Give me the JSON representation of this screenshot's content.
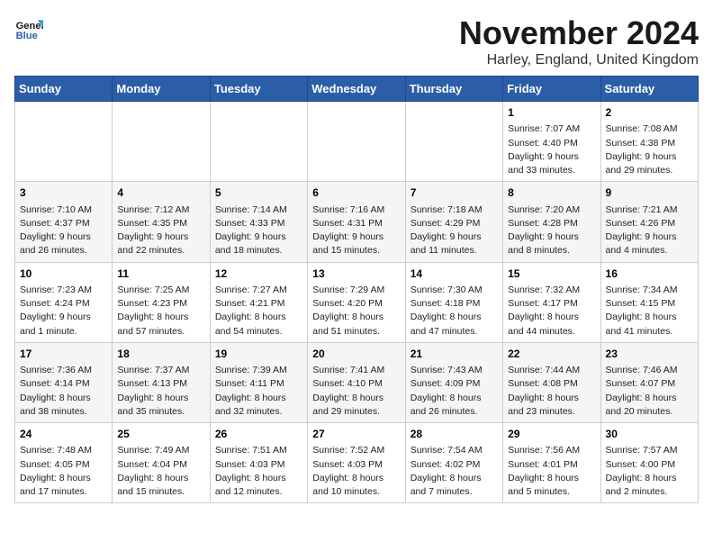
{
  "logo": {
    "text_general": "General",
    "text_blue": "Blue"
  },
  "title": "November 2024",
  "location": "Harley, England, United Kingdom",
  "days_of_week": [
    "Sunday",
    "Monday",
    "Tuesday",
    "Wednesday",
    "Thursday",
    "Friday",
    "Saturday"
  ],
  "weeks": [
    [
      {
        "day": "",
        "info": ""
      },
      {
        "day": "",
        "info": ""
      },
      {
        "day": "",
        "info": ""
      },
      {
        "day": "",
        "info": ""
      },
      {
        "day": "",
        "info": ""
      },
      {
        "day": "1",
        "info": "Sunrise: 7:07 AM\nSunset: 4:40 PM\nDaylight: 9 hours and 33 minutes."
      },
      {
        "day": "2",
        "info": "Sunrise: 7:08 AM\nSunset: 4:38 PM\nDaylight: 9 hours and 29 minutes."
      }
    ],
    [
      {
        "day": "3",
        "info": "Sunrise: 7:10 AM\nSunset: 4:37 PM\nDaylight: 9 hours and 26 minutes."
      },
      {
        "day": "4",
        "info": "Sunrise: 7:12 AM\nSunset: 4:35 PM\nDaylight: 9 hours and 22 minutes."
      },
      {
        "day": "5",
        "info": "Sunrise: 7:14 AM\nSunset: 4:33 PM\nDaylight: 9 hours and 18 minutes."
      },
      {
        "day": "6",
        "info": "Sunrise: 7:16 AM\nSunset: 4:31 PM\nDaylight: 9 hours and 15 minutes."
      },
      {
        "day": "7",
        "info": "Sunrise: 7:18 AM\nSunset: 4:29 PM\nDaylight: 9 hours and 11 minutes."
      },
      {
        "day": "8",
        "info": "Sunrise: 7:20 AM\nSunset: 4:28 PM\nDaylight: 9 hours and 8 minutes."
      },
      {
        "day": "9",
        "info": "Sunrise: 7:21 AM\nSunset: 4:26 PM\nDaylight: 9 hours and 4 minutes."
      }
    ],
    [
      {
        "day": "10",
        "info": "Sunrise: 7:23 AM\nSunset: 4:24 PM\nDaylight: 9 hours and 1 minute."
      },
      {
        "day": "11",
        "info": "Sunrise: 7:25 AM\nSunset: 4:23 PM\nDaylight: 8 hours and 57 minutes."
      },
      {
        "day": "12",
        "info": "Sunrise: 7:27 AM\nSunset: 4:21 PM\nDaylight: 8 hours and 54 minutes."
      },
      {
        "day": "13",
        "info": "Sunrise: 7:29 AM\nSunset: 4:20 PM\nDaylight: 8 hours and 51 minutes."
      },
      {
        "day": "14",
        "info": "Sunrise: 7:30 AM\nSunset: 4:18 PM\nDaylight: 8 hours and 47 minutes."
      },
      {
        "day": "15",
        "info": "Sunrise: 7:32 AM\nSunset: 4:17 PM\nDaylight: 8 hours and 44 minutes."
      },
      {
        "day": "16",
        "info": "Sunrise: 7:34 AM\nSunset: 4:15 PM\nDaylight: 8 hours and 41 minutes."
      }
    ],
    [
      {
        "day": "17",
        "info": "Sunrise: 7:36 AM\nSunset: 4:14 PM\nDaylight: 8 hours and 38 minutes."
      },
      {
        "day": "18",
        "info": "Sunrise: 7:37 AM\nSunset: 4:13 PM\nDaylight: 8 hours and 35 minutes."
      },
      {
        "day": "19",
        "info": "Sunrise: 7:39 AM\nSunset: 4:11 PM\nDaylight: 8 hours and 32 minutes."
      },
      {
        "day": "20",
        "info": "Sunrise: 7:41 AM\nSunset: 4:10 PM\nDaylight: 8 hours and 29 minutes."
      },
      {
        "day": "21",
        "info": "Sunrise: 7:43 AM\nSunset: 4:09 PM\nDaylight: 8 hours and 26 minutes."
      },
      {
        "day": "22",
        "info": "Sunrise: 7:44 AM\nSunset: 4:08 PM\nDaylight: 8 hours and 23 minutes."
      },
      {
        "day": "23",
        "info": "Sunrise: 7:46 AM\nSunset: 4:07 PM\nDaylight: 8 hours and 20 minutes."
      }
    ],
    [
      {
        "day": "24",
        "info": "Sunrise: 7:48 AM\nSunset: 4:05 PM\nDaylight: 8 hours and 17 minutes."
      },
      {
        "day": "25",
        "info": "Sunrise: 7:49 AM\nSunset: 4:04 PM\nDaylight: 8 hours and 15 minutes."
      },
      {
        "day": "26",
        "info": "Sunrise: 7:51 AM\nSunset: 4:03 PM\nDaylight: 8 hours and 12 minutes."
      },
      {
        "day": "27",
        "info": "Sunrise: 7:52 AM\nSunset: 4:03 PM\nDaylight: 8 hours and 10 minutes."
      },
      {
        "day": "28",
        "info": "Sunrise: 7:54 AM\nSunset: 4:02 PM\nDaylight: 8 hours and 7 minutes."
      },
      {
        "day": "29",
        "info": "Sunrise: 7:56 AM\nSunset: 4:01 PM\nDaylight: 8 hours and 5 minutes."
      },
      {
        "day": "30",
        "info": "Sunrise: 7:57 AM\nSunset: 4:00 PM\nDaylight: 8 hours and 2 minutes."
      }
    ]
  ]
}
